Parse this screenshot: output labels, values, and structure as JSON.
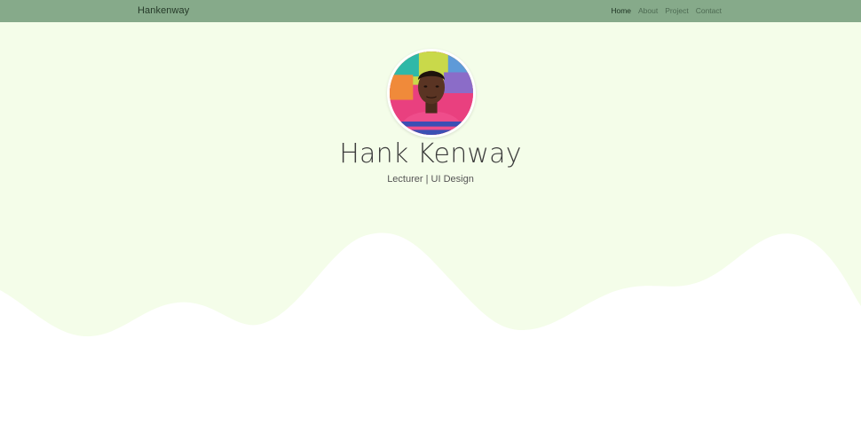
{
  "navbar": {
    "brand": "Hankenway",
    "links": [
      {
        "label": "Home",
        "active": true
      },
      {
        "label": "About",
        "active": false
      },
      {
        "label": "Project",
        "active": false
      },
      {
        "label": "Contact",
        "active": false
      }
    ]
  },
  "profile": {
    "name": "Hank Kenway",
    "subtitle": "Lecturer | UI Design"
  },
  "colors": {
    "navbar_bg": "#86aa8a",
    "hero_bg": "#f4fde9",
    "page_bg": "#ffffff"
  }
}
